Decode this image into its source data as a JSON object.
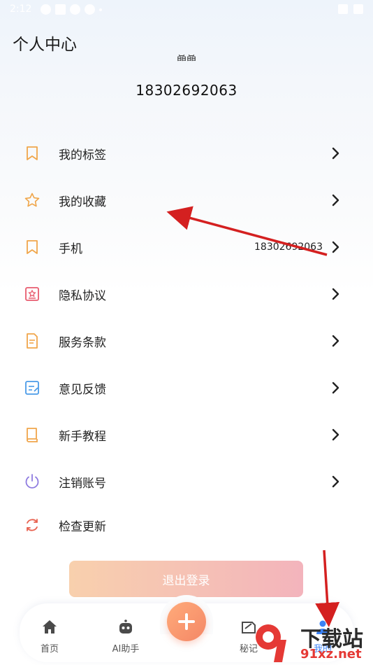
{
  "status_bar": {
    "time": "2:12"
  },
  "header": {
    "title": "个人中心",
    "username": "晶晶",
    "phone": "18302692063"
  },
  "menu": [
    {
      "label": "我的标签",
      "value": "",
      "icon": "bookmark-icon",
      "color": "#f0a64b",
      "chevron": true
    },
    {
      "label": "我的收藏",
      "value": "",
      "icon": "star-icon",
      "color": "#f0a64b",
      "chevron": true
    },
    {
      "label": "手机",
      "value": "18302692063",
      "icon": "bookmark-icon",
      "color": "#f0a64b",
      "chevron": true
    },
    {
      "label": "隐私协议",
      "value": "",
      "icon": "privacy-icon",
      "color": "#e85b6e",
      "chevron": true
    },
    {
      "label": "服务条款",
      "value": "",
      "icon": "document-icon",
      "color": "#f0a64b",
      "chevron": true
    },
    {
      "label": "意见反馈",
      "value": "",
      "icon": "feedback-icon",
      "color": "#4a9be8",
      "chevron": true
    },
    {
      "label": "新手教程",
      "value": "",
      "icon": "book-icon",
      "color": "#f0a64b",
      "chevron": true
    },
    {
      "label": "注销账号",
      "value": "",
      "icon": "power-icon",
      "color": "#8e7be0",
      "chevron": true
    },
    {
      "label": "检查更新",
      "value": "",
      "icon": "refresh-icon",
      "color": "#e8614f",
      "chevron": false
    }
  ],
  "logout_label": "退出登录",
  "bottom_nav": {
    "home_label": "首页",
    "ai_label": "AI助手",
    "notes_label": "秘记",
    "mine_label": "我的"
  },
  "watermark": {
    "line1": "下载站",
    "line2": "91xz.net"
  },
  "colors": {
    "accent_orange": "#f0a64b",
    "arrow_red": "#d42020",
    "fab": "#f48766"
  }
}
